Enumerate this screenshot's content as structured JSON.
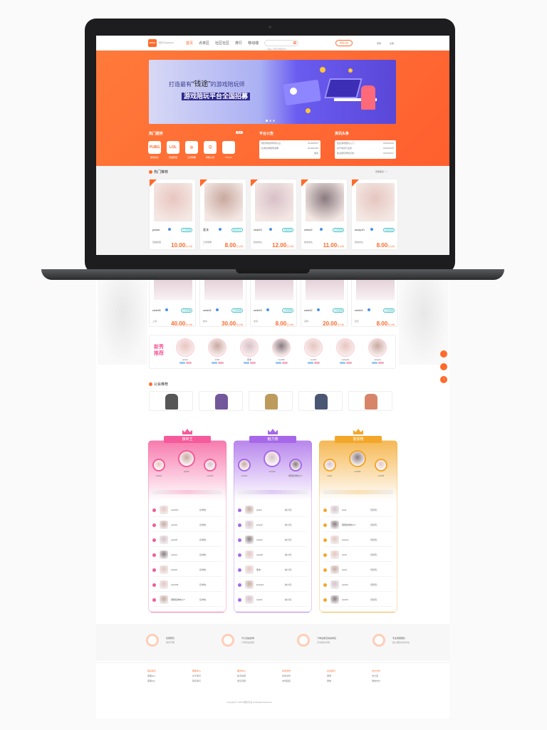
{
  "header": {
    "logo_text": "BKGE",
    "logo_sub": "陪玩平台DEMO",
    "nav": [
      "首页",
      "点单区",
      "社区社区",
      "排行",
      "移动端"
    ],
    "search_placeholder": "请输入陪玩师昵称ID",
    "cta": "申请入驻",
    "login": "登录",
    "register": "注册"
  },
  "banner": {
    "line1a": "打造最有",
    "line1b": "“钱途”",
    "line1c": "的游戏陪玩师",
    "line2": "游戏陪玩平台全国招募"
  },
  "hot_services": {
    "title": "热门服务",
    "more": "更多",
    "games": [
      {
        "icon": "PUBG",
        "name": "绝地求生"
      },
      {
        "icon": "LOL",
        "name": "英雄联盟"
      },
      {
        "icon": "◎",
        "name": "王者荣耀"
      },
      {
        "icon": "Ｑ",
        "name": "穿越火线"
      },
      {
        "icon": "",
        "name": "CS:GO"
      }
    ]
  },
  "notice": {
    "title": "平台公告",
    "items": [
      {
        "text": "陪玩师如何申请认证",
        "date": "2019/05/07"
      },
      {
        "text": "礼物系统规则说明",
        "date": "2019/04/20"
      }
    ],
    "more": "更多"
  },
  "news": {
    "title": "资讯头条",
    "items": [
      {
        "text": "最全游戏陪玩入门...",
        "date": "2019/10/22"
      },
      {
        "text": "关于电竞行业的...",
        "date": "2019/10/15"
      },
      {
        "text": "职业陪玩师的日常...",
        "date": "2019/10/17"
      }
    ]
  },
  "hot_recommend": {
    "title": "热门推荐",
    "more": "查看更多 > >",
    "row1": [
      {
        "name": "picker",
        "tag": "王者荣耀",
        "sub": "英雄联盟",
        "price": "10.00",
        "unit": "元/小时"
      },
      {
        "name": "夏沫",
        "tag": "绝地求生",
        "sub": "王者荣耀",
        "price": "8.00",
        "unit": "元/小时"
      },
      {
        "name": "ceshi3",
        "tag": "英雄联盟",
        "sub": "绝地求生",
        "price": "12.00",
        "unit": "元/小时"
      },
      {
        "name": "ceshi2",
        "tag": "王者荣耀",
        "sub": "绝地求生",
        "price": "11.00",
        "unit": "元/小时"
      },
      {
        "name": "lucky10",
        "tag": "英雄联盟",
        "sub": "绝地求生",
        "price": "8.00",
        "unit": "元/小时"
      }
    ],
    "row2": [
      {
        "name": "ceshi5",
        "tag": "王者荣耀",
        "sub": "上海",
        "price": "40.00",
        "unit": "元/小时"
      },
      {
        "name": "ceshi4",
        "tag": "王者荣耀",
        "sub": "杭州",
        "price": "30.00",
        "unit": "元/小时"
      },
      {
        "name": "ceshi3",
        "tag": "王者荣耀",
        "sub": "北京",
        "price": "8.00",
        "unit": "元/小时"
      },
      {
        "name": "ceshi2",
        "tag": "王者荣耀",
        "sub": "深圳",
        "price": "20.00",
        "unit": "元/小时"
      },
      {
        "name": "ceshi1",
        "tag": "王者荣耀",
        "sub": "武汉",
        "price": "8.00",
        "unit": "元/小时"
      }
    ]
  },
  "newcomers": {
    "title_a": "新秀",
    "title_b": "推荐",
    "people": [
      "picker",
      "1234",
      "夏沫",
      "ceshi8",
      "ceshi2",
      "lucky10",
      "lucky9"
    ]
  },
  "guild": {
    "title": "公会推荐"
  },
  "rank": {
    "cols": [
      {
        "title": "接单王",
        "color": "#f55a9a",
        "top3": [
          "ceshi1",
          "picker",
          "ceshi2"
        ],
        "list": [
          "ceshi10",
          "ceshi9",
          "ceshi8",
          "ceshi4",
          "ceshi5",
          "ceshi02",
          "刚刚接单的小7"
        ],
        "metric": "接单数："
      },
      {
        "title": "魅力榜",
        "color": "#a668e8",
        "top3": [
          "ceshi1",
          "lucky9",
          "刚刚接单的小7"
        ],
        "list": [
          "picker",
          "lucky9",
          "ceshi2",
          "ceshi8",
          "夏沫",
          "lucky10",
          "ceshi1"
        ],
        "metric": "魅力值："
      },
      {
        "title": "富豪榜",
        "color": "#f3a72a",
        "top3": [
          "lucky",
          "ceshi2",
          "ceshi3"
        ],
        "list": [
          "test1",
          "刚刚接单的小7",
          "picker1",
          "1234",
          "ceshi",
          "ceshi2",
          "ceshi3"
        ],
        "metric": "贡献值："
      }
    ]
  },
  "features": [
    {
      "t1": "优质陪玩",
      "t2": "随时开黑"
    },
    {
      "t1": "可以自由接单",
      "t2": "订单自由选取"
    },
    {
      "t1": "下单后保证快速响应",
      "t2": "及时解决问题"
    },
    {
      "t1": "专业客服团队",
      "t2": "贴心服务在你身边"
    }
  ],
  "footer": {
    "cols": [
      {
        "title": "联系我们",
        "items": [
          "客服QQ",
          "客服QQ"
        ]
      },
      {
        "title": "帮助中心",
        "items": [
          "关于我们",
          "联系我们"
        ]
      },
      {
        "title": "服务中心",
        "items": [
          "新手指南",
          "常见问题"
        ]
      },
      {
        "title": "商务合作",
        "items": [
          "商务合作",
          "友情链接"
        ]
      },
      {
        "title": "关注我们",
        "items": [
          "微博",
          "微信"
        ]
      },
      {
        "title": "支付方式",
        "items": [
          "支付宝",
          "微信支付"
        ]
      }
    ],
    "copyright": "Copyright © 2019 陪玩平台 All Rights Reserved"
  },
  "colors": {
    "accent": "#ff6a2b",
    "pink": "#f55a9a",
    "purple": "#a668e8",
    "gold": "#f3a72a"
  }
}
